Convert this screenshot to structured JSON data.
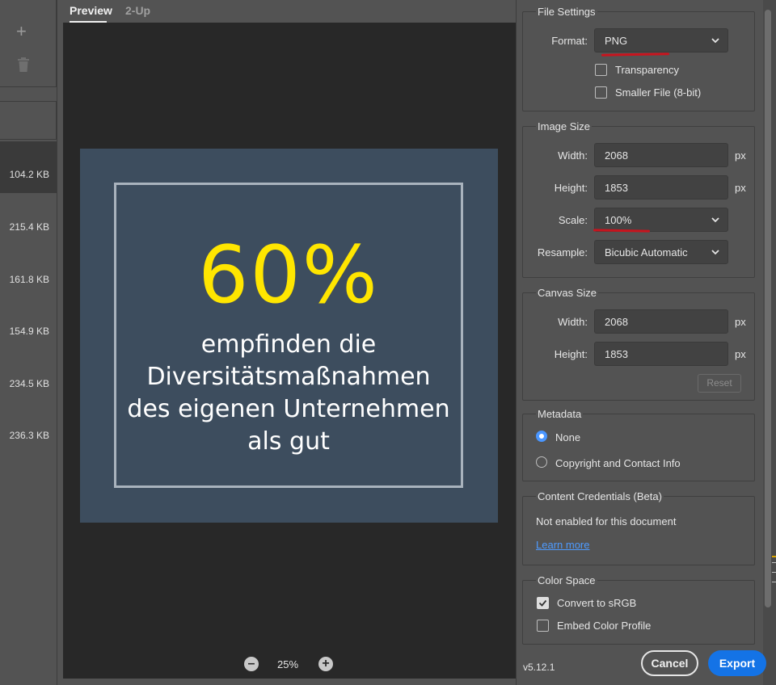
{
  "left": {
    "file_sizes": [
      "104.2 KB",
      "215.4 KB",
      "161.8 KB",
      "154.9 KB",
      "234.5 KB",
      "236.3 KB"
    ]
  },
  "preview": {
    "tabs": [
      "Preview",
      "2-Up"
    ],
    "zoom": "25%",
    "artwork": {
      "headline": "60%",
      "lines": [
        "empfinden die",
        "Diversitätsmaßnahmen",
        "des eigenen Unternehmen",
        "als gut"
      ]
    }
  },
  "file_settings": {
    "title": "File Settings",
    "format_label": "Format:",
    "format_value": "PNG",
    "transparency_label": "Transparency",
    "transparency_checked": false,
    "smaller_file_label": "Smaller File (8-bit)",
    "smaller_file_checked": false
  },
  "image_size": {
    "title": "Image Size",
    "width_label": "Width:",
    "width_value": "2068",
    "height_label": "Height:",
    "height_value": "1853",
    "scale_label": "Scale:",
    "scale_value": "100%",
    "resample_label": "Resample:",
    "resample_value": "Bicubic Automatic",
    "unit": "px"
  },
  "canvas_size": {
    "title": "Canvas Size",
    "width_label": "Width:",
    "width_value": "2068",
    "height_label": "Height:",
    "height_value": "1853",
    "unit": "px",
    "reset_label": "Reset"
  },
  "metadata": {
    "title": "Metadata",
    "options": [
      "None",
      "Copyright and Contact Info"
    ],
    "selected": "None"
  },
  "content_credentials": {
    "title": "Content Credentials (Beta)",
    "status": "Not enabled for this document",
    "link": "Learn more"
  },
  "color_space": {
    "title": "Color Space",
    "convert_label": "Convert to sRGB",
    "convert_checked": true,
    "embed_label": "Embed Color Profile",
    "embed_checked": false
  },
  "footer": {
    "version": "v5.12.1",
    "cancel_label": "Cancel",
    "export_label": "Export"
  },
  "colors": {
    "accent": "#1473e6",
    "link": "#4e9bff",
    "highlight_yellow": "#ffe600",
    "artwork_bg": "#3d4d5e",
    "annotation_red": "#c8141e"
  }
}
